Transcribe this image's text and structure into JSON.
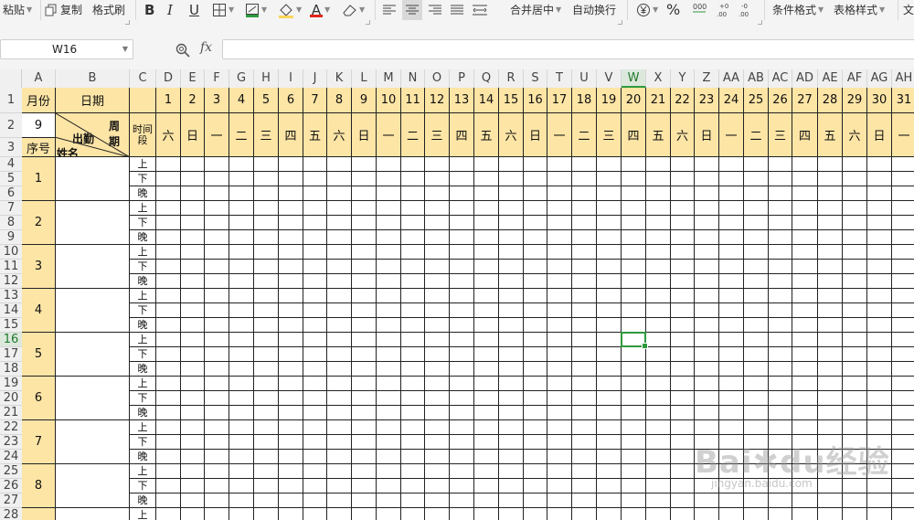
{
  "toolbar": {
    "paste": "粘贴",
    "copy": "复制",
    "format_painter": "格式刷",
    "merge_center": "合并居中",
    "auto_wrap": "自动换行",
    "percent": "%",
    "conditional_format": "条件格式",
    "table_style": "表格样式",
    "overflow": "文"
  },
  "formula_bar": {
    "cell_ref": "W16",
    "fx_label": "fx",
    "formula": ""
  },
  "columns": [
    "A",
    "B",
    "C",
    "D",
    "E",
    "F",
    "G",
    "H",
    "I",
    "J",
    "K",
    "L",
    "M",
    "N",
    "O",
    "P",
    "Q",
    "R",
    "S",
    "T",
    "U",
    "V",
    "W",
    "X",
    "Y",
    "Z",
    "AA",
    "AB",
    "AC",
    "AD",
    "AE",
    "AF",
    "AG",
    "AH"
  ],
  "selected_column": "W",
  "rows": [
    "1",
    "2",
    "3",
    "4",
    "5",
    "6",
    "7",
    "8",
    "9",
    "10",
    "11",
    "12",
    "13",
    "14",
    "15",
    "16",
    "17",
    "18",
    "19",
    "20",
    "21",
    "22",
    "23",
    "24",
    "25",
    "26",
    "27",
    "28"
  ],
  "selected_row": "16",
  "sheet": {
    "month_label": "月份",
    "month_value": "9",
    "date_label": "日期",
    "week_label": "周期",
    "attendance_label": "出勤",
    "name_label": "姓名",
    "serial_label": "序号",
    "time_period_label": "时间段",
    "days": [
      "1",
      "2",
      "3",
      "4",
      "5",
      "6",
      "7",
      "8",
      "9",
      "10",
      "11",
      "12",
      "13",
      "14",
      "15",
      "16",
      "17",
      "18",
      "19",
      "20",
      "21",
      "22",
      "23",
      "24",
      "25",
      "26",
      "27",
      "28",
      "29",
      "30",
      "31"
    ],
    "weekdays": [
      "六",
      "日",
      "一",
      "二",
      "三",
      "四",
      "五",
      "六",
      "日",
      "一",
      "二",
      "三",
      "四",
      "五",
      "六",
      "日",
      "一",
      "二",
      "三",
      "四",
      "五",
      "六",
      "日",
      "一",
      "二",
      "三",
      "四",
      "五",
      "六",
      "日",
      "一"
    ],
    "serials": [
      "1",
      "2",
      "3",
      "4",
      "5",
      "6",
      "7",
      "8"
    ],
    "periods": [
      "上",
      "下",
      "晚"
    ]
  },
  "watermark": {
    "brand": "Bai",
    "brand2": "du",
    "brand_cn": "经验",
    "url": "jingyan.baidu.com"
  }
}
